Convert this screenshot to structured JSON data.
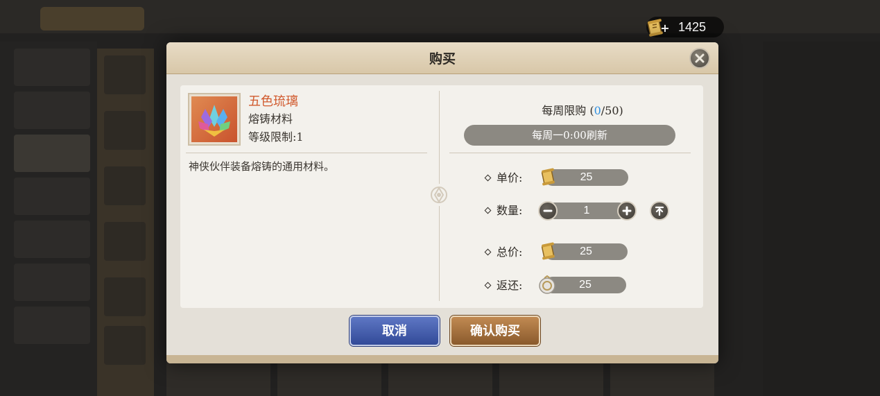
{
  "currency": {
    "icon": "scroll-currency-icon",
    "plus_icon": "plus-icon",
    "amount": "1425"
  },
  "dialog": {
    "title": "购买",
    "close_icon": "close-icon"
  },
  "item": {
    "name": "五色琉璃",
    "type": "熔铸材料",
    "level_limit": "等级限制:1",
    "description": "神侠伙伴装备熔铸的通用材料。",
    "icon": "crystal-lotus-icon"
  },
  "purchase": {
    "weekly_limit_prefix": "每周限购 (",
    "weekly_limit_bought": "0",
    "weekly_limit_suffix": "/50)",
    "refresh_text": "每周一0:00刷新",
    "unit_price_label": "单价:",
    "unit_price": "25",
    "quantity_label": "数量:",
    "quantity": "1",
    "total_label": "总价:",
    "total_price": "25",
    "refund_label": "返还:",
    "refund_amount": "25"
  },
  "buttons": {
    "cancel": "取消",
    "confirm": "确认购买"
  },
  "colors": {
    "item_name": "#d15a2e",
    "limit_count": "#2e8fe0",
    "cancel_button": "#324a98",
    "confirm_button": "#8a5a2c"
  }
}
